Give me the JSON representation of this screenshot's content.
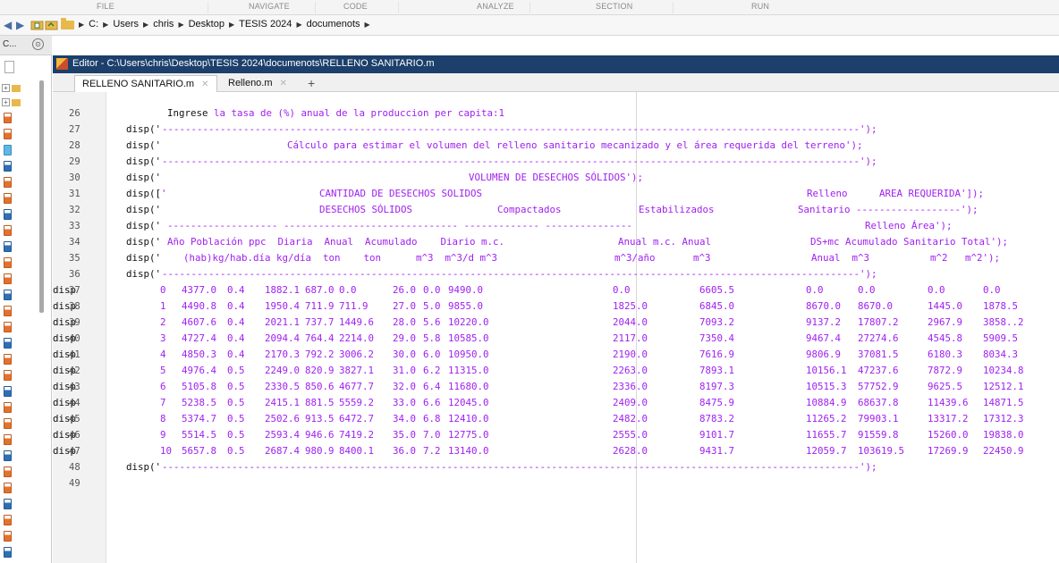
{
  "toolstrip": {
    "tabs": [
      "FILE",
      "NAVIGATE",
      "CODE",
      "ANALYZE",
      "SECTION",
      "RUN"
    ]
  },
  "address": {
    "crumbs": [
      "C:",
      "Users",
      "chris",
      "Desktop",
      "TESIS 2024",
      "documenots"
    ]
  },
  "left_panel": {
    "header_label": "C...",
    "header_button": "⊙"
  },
  "editor": {
    "title": "Editor - C:\\Users\\chris\\Desktop\\TESIS 2024\\documenots\\RELLENO SANITARIO.m",
    "tabs": [
      {
        "label": "RELLENO SANITARIO.m",
        "close": "✕"
      },
      {
        "label": "Relleno.m",
        "close": "✕"
      }
    ],
    "add_tab": "+"
  },
  "code": {
    "line26": {
      "num": "26",
      "prefix": "Ingrese ",
      "text": "la tasa de (%) anual de la produccion per capita:1"
    },
    "line27": {
      "num": "27",
      "disp": "disp('",
      "dashes": "------------------------------------------------------------------------------------------------------------------------');"
    },
    "line28": {
      "num": "28",
      "disp": "disp('",
      "text": "Cálculo para estimar el volumen del relleno sanitario mecanizado y el área requerida del terreno');"
    },
    "line29": {
      "num": "29",
      "disp": "disp('",
      "dashes": "------------------------------------------------------------------------------------------------------------------------');"
    },
    "line30": {
      "num": "30",
      "disp": "disp('",
      "text": "VOLUMEN DE DESECHOS SÓLIDOS');"
    },
    "line31": {
      "num": "31",
      "disp": "disp([",
      "q": "'",
      "a": "CANTIDAD DE DESECHOS SOLIDOS",
      "b": "Relleno",
      "c": "AREA REQUERIDA']);"
    },
    "line32": {
      "num": "32",
      "disp": "disp('",
      "a": "DESECHOS SÓLIDOS",
      "b": "Compactados",
      "c": "Estabilizados",
      "d": "Sanitario ------------------');"
    },
    "line33": {
      "num": "33",
      "disp": "disp('",
      "a": "------------------- ------------------------------ ------------- ---------------",
      "b": "Relleno Área');"
    },
    "line34": {
      "num": "34",
      "disp": "disp('",
      "a": "Año Población ppc  Diaria  Anual  Acumulado    Diario m.c.",
      "b": "Anual m.c. Anual",
      "c": "DS+mc Acumulado Sanitario Total');"
    },
    "line35": {
      "num": "35",
      "disp": "disp('",
      "a": "(hab)kg/hab.día kg/día  ton    ton      m^3  m^3/d m^3",
      "b": "m^3/año",
      "c": "m^3",
      "d": "Anual  m^3",
      "e": "m^2   m^2');"
    },
    "line36": {
      "num": "36",
      "disp": "disp('",
      "dashes": "------------------------------------------------------------------------------------------------------------------------');"
    },
    "line48": {
      "num": "48",
      "disp": "disp('",
      "dashes": "------------------------------------------------------------------------------------------------------------------------');"
    },
    "line49": {
      "num": "49"
    }
  },
  "table_rows": [
    {
      "num": "37",
      "disp": "disp",
      "i": "0",
      "c1": "4377.0",
      "c2": "0.4",
      "c3": "1882.1",
      "c4": "687.0",
      "c5": "0.0",
      "c6": "26.0",
      "c7": "0.0",
      "c8": "9490.0",
      "c9": "0.0",
      "c10": "6605.5",
      "c11": "0.0",
      "c12": "0.0",
      "c13": "0.0",
      "c14": "0.0"
    },
    {
      "num": "38",
      "disp": "disp",
      "i": "1",
      "c1": "4490.8",
      "c2": "0.4",
      "c3": "1950.4",
      "c4": "711.9",
      "c5": "711.9",
      "c6": "27.0",
      "c7": "5.0",
      "c8": "9855.0",
      "c9": "1825.0",
      "c10": "6845.0",
      "c11": "8670.0",
      "c12": "8670.0",
      "c13": "1445.0",
      "c14": "1878.5"
    },
    {
      "num": "39",
      "disp": "disp",
      "i": "2",
      "c1": "4607.6",
      "c2": "0.4",
      "c3": "2021.1",
      "c4": "737.7",
      "c5": "1449.6",
      "c6": "28.0",
      "c7": "5.6",
      "c8": "10220.0",
      "c9": "2044.0",
      "c10": "7093.2",
      "c11": "9137.2",
      "c12": "17807.2",
      "c13": "2967.9",
      "c14": "3858..2"
    },
    {
      "num": "40",
      "disp": "disp",
      "i": "3",
      "c1": "4727.4",
      "c2": "0.4",
      "c3": "2094.4",
      "c4": "764.4",
      "c5": "2214.0",
      "c6": "29.0",
      "c7": "5.8",
      "c8": "10585.0",
      "c9": "2117.0",
      "c10": "7350.4",
      "c11": "9467.4",
      "c12": "27274.6",
      "c13": "4545.8",
      "c14": "5909.5"
    },
    {
      "num": "41",
      "disp": "disp",
      "i": "4",
      "c1": "4850.3",
      "c2": "0.4",
      "c3": "2170.3",
      "c4": "792.2",
      "c5": "3006.2",
      "c6": "30.0",
      "c7": "6.0",
      "c8": "10950.0",
      "c9": "2190.0",
      "c10": "7616.9",
      "c11": "9806.9",
      "c12": "37081.5",
      "c13": "6180.3",
      "c14": "8034.3"
    },
    {
      "num": "42",
      "disp": "disp",
      "i": "5",
      "c1": "4976.4",
      "c2": "0.5",
      "c3": "2249.0",
      "c4": "820.9",
      "c5": "3827.1",
      "c6": "31.0",
      "c7": "6.2",
      "c8": "11315.0",
      "c9": "2263.0",
      "c10": "7893.1",
      "c11": "10156.1",
      "c12": "47237.6",
      "c13": "7872.9",
      "c14": "10234.8"
    },
    {
      "num": "43",
      "disp": "disp",
      "i": "6",
      "c1": "5105.8",
      "c2": "0.5",
      "c3": "2330.5",
      "c4": "850.6",
      "c5": "4677.7",
      "c6": "32.0",
      "c7": "6.4",
      "c8": "11680.0",
      "c9": "2336.0",
      "c10": "8197.3",
      "c11": "10515.3",
      "c12": "57752.9",
      "c13": "9625.5",
      "c14": "12512.1"
    },
    {
      "num": "44",
      "disp": "disp",
      "i": "7",
      "c1": "5238.5",
      "c2": "0.5",
      "c3": "2415.1",
      "c4": "881.5",
      "c5": "5559.2",
      "c6": "33.0",
      "c7": "6.6",
      "c8": "12045.0",
      "c9": "2409.0",
      "c10": "8475.9",
      "c11": "10884.9",
      "c12": "68637.8",
      "c13": "11439.6",
      "c14": "14871.5"
    },
    {
      "num": "45",
      "disp": "disp",
      "i": "8",
      "c1": "5374.7",
      "c2": "0.5",
      "c3": "2502.6",
      "c4": "913.5",
      "c5": "6472.7",
      "c6": "34.0",
      "c7": "6.8",
      "c8": "12410.0",
      "c9": "2482.0",
      "c10": "8783.2",
      "c11": "11265.2",
      "c12": "79903.1",
      "c13": "13317.2",
      "c14": "17312.3"
    },
    {
      "num": "46",
      "disp": "disp",
      "i": "9",
      "c1": "5514.5",
      "c2": "0.5",
      "c3": "2593.4",
      "c4": "946.6",
      "c5": "7419.2",
      "c6": "35.0",
      "c7": "7.0",
      "c8": "12775.0",
      "c9": "2555.0",
      "c10": "9101.7",
      "c11": "11655.7",
      "c12": "91559.8",
      "c13": "15260.0",
      "c14": "19838.0"
    },
    {
      "num": "47",
      "disp": "disp",
      "i": "10",
      "c1": "5657.8",
      "c2": "0.5",
      "c3": "2687.4",
      "c4": "980.9",
      "c5": "8400.1",
      "c6": "36.0",
      "c7": "7.2",
      "c8": "13140.0",
      "c9": "2628.0",
      "c10": "9431.7",
      "c11": "12059.7",
      "c12": "103619.5",
      "c13": "17269.9",
      "c14": "22450.9"
    }
  ],
  "colors": {
    "string": "#a020f0",
    "editor_title_bg": "#1c3f6b",
    "folder": "#e8b94a"
  }
}
